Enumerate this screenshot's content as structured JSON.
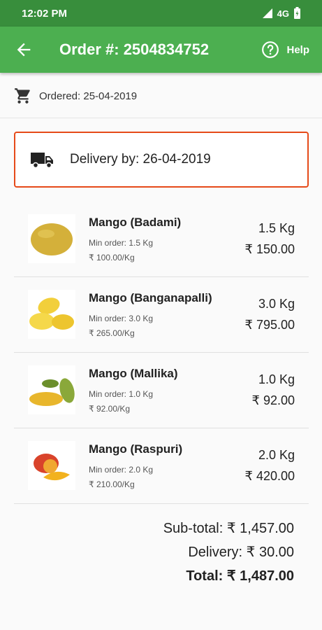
{
  "status": {
    "time": "12:02 PM",
    "network": "4G"
  },
  "header": {
    "title": "Order #: 2504834752",
    "help_label": "Help"
  },
  "order": {
    "ordered": "Ordered: 25-04-2019",
    "delivery": "Delivery by: 26-04-2019"
  },
  "items": [
    {
      "name": "Mango (Badami)",
      "min": "Min order: 1.5 Kg",
      "rate": "₹ 100.00/Kg",
      "qty": "1.5 Kg",
      "price": "₹ 150.00"
    },
    {
      "name": "Mango (Banganapalli)",
      "min": "Min order: 3.0 Kg",
      "rate": "₹ 265.00/Kg",
      "qty": "3.0 Kg",
      "price": "₹ 795.00"
    },
    {
      "name": "Mango (Mallika)",
      "min": "Min order: 1.0 Kg",
      "rate": "₹ 92.00/Kg",
      "qty": "1.0 Kg",
      "price": "₹ 92.00"
    },
    {
      "name": "Mango (Raspuri)",
      "min": "Min order: 2.0 Kg",
      "rate": "₹ 210.00/Kg",
      "qty": "2.0 Kg",
      "price": "₹ 420.00"
    }
  ],
  "totals": {
    "subtotal": "Sub-total: ₹ 1,457.00",
    "delivery": "Delivery: ₹ 30.00",
    "total": "Total: ₹ 1,487.00"
  },
  "colors": {
    "appbar": "#4caf50",
    "statusbar": "#388e3c",
    "delivery_border": "#e64a19"
  }
}
